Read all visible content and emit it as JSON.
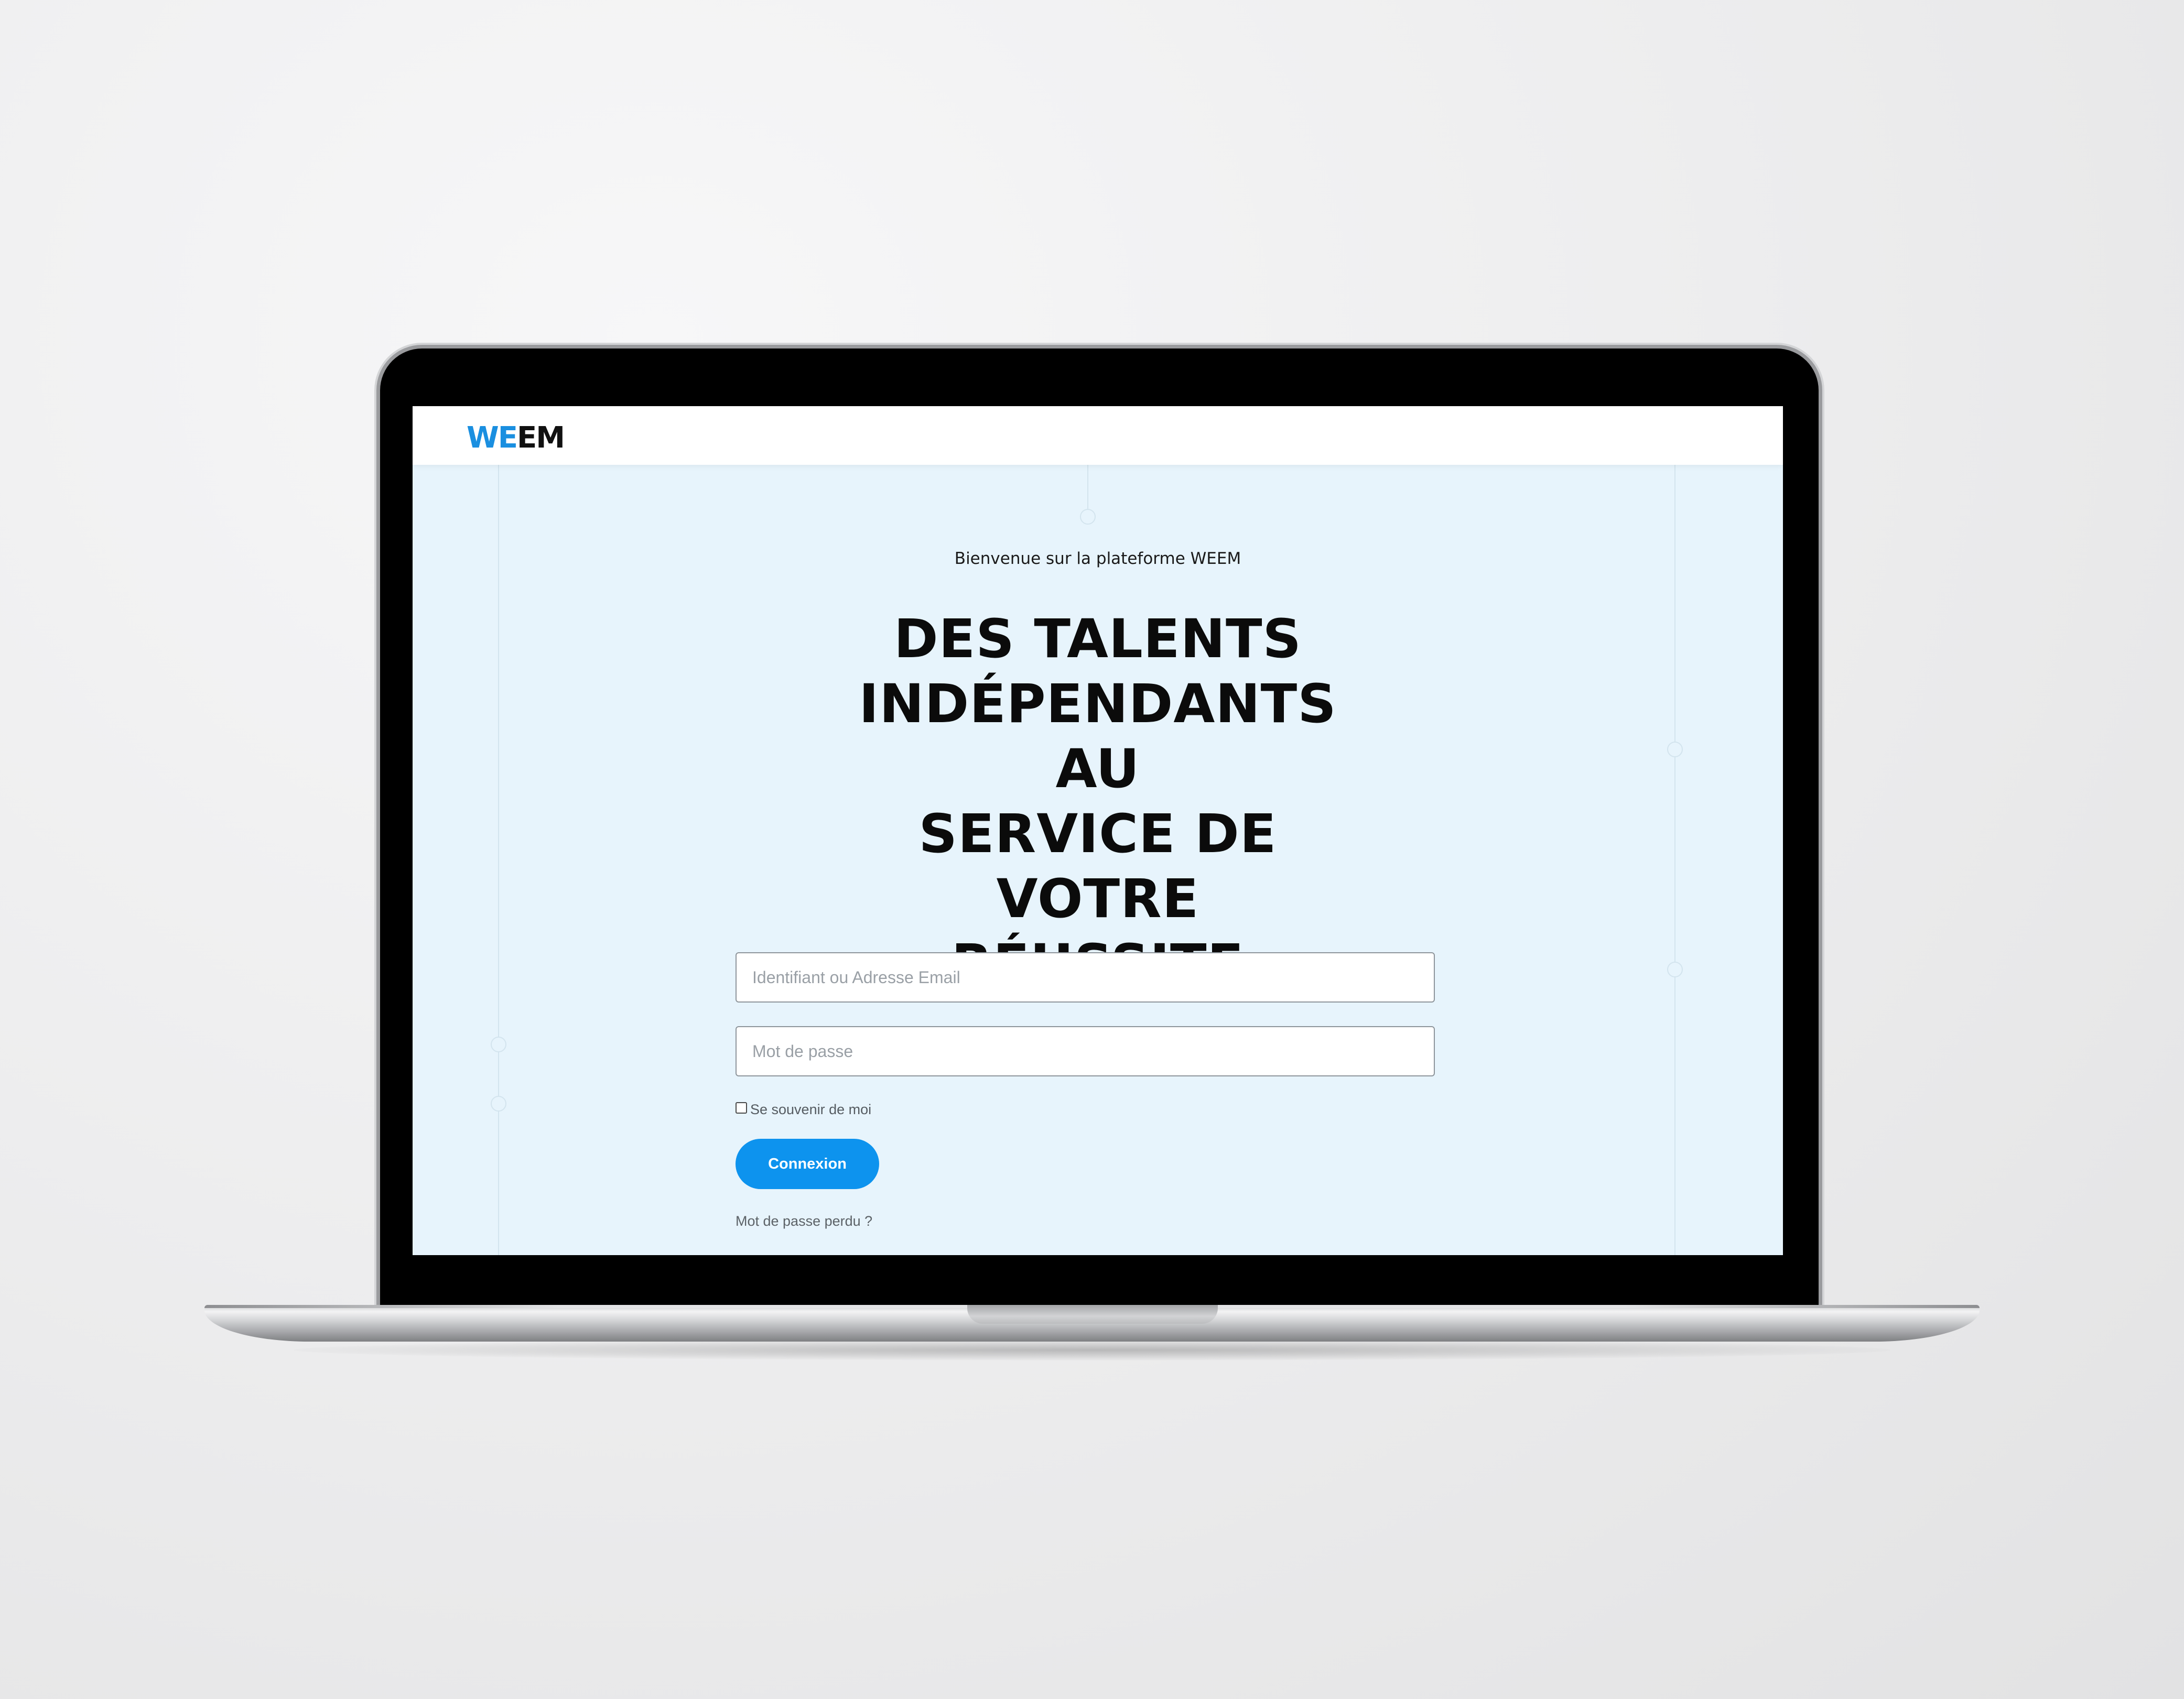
{
  "header": {
    "logo_part1": "WE",
    "logo_part2": "EM"
  },
  "main": {
    "welcome_text": "Bienvenue sur la plateforme WEEM",
    "headline_lines": [
      "DES TALENTS",
      "INDÉPENDANTS AU",
      "SERVICE DE VOTRE",
      "RÉUSSITE"
    ]
  },
  "login_form": {
    "login_placeholder": "Identifiant ou Adresse Email",
    "login_value": "",
    "password_placeholder": "Mot de passe",
    "password_value": "",
    "remember_label": "Se souvenir de moi",
    "remember_checked": false,
    "submit_label": "Connexion",
    "lost_password_label": "Mot de passe perdu ?"
  },
  "colors": {
    "brand_blue": "#0d93ee",
    "logo_blue": "#1a8fe0",
    "page_background": "#e7f4fc",
    "text_dark": "#0b0b0b"
  }
}
